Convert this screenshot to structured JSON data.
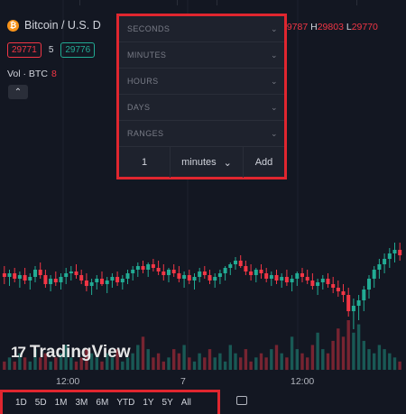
{
  "symbol": {
    "title": "Bitcoin / U.S. D",
    "coin_glyph": "₿",
    "ohlc": {
      "close_value": "29787",
      "high_label": "H",
      "high_value": "29803",
      "low_label": "L",
      "low_value": "29770"
    },
    "sell_price": "29771",
    "spread": "5",
    "buy_price": "29776"
  },
  "volume": {
    "label": "Vol · BTC",
    "value": "8"
  },
  "collapse_glyph": "⌃",
  "interval_panel": {
    "sections": [
      "SECONDS",
      "MINUTES",
      "HOURS",
      "DAYS",
      "RANGES"
    ],
    "chevron": "⌄",
    "custom": {
      "value": "1",
      "unit": "minutes",
      "unit_chevron": "⌄",
      "add_label": "Add"
    }
  },
  "logo": {
    "mark": "17",
    "text": "TradingView"
  },
  "xaxis": {
    "labels": [
      "12:00",
      "7",
      "12:00"
    ]
  },
  "range_bar": {
    "items": [
      "1D",
      "5D",
      "1M",
      "3M",
      "6M",
      "YTD",
      "1Y",
      "5Y",
      "All"
    ]
  },
  "colors": {
    "up": "#22ab94",
    "down": "#f23645",
    "highlight": "#e0262f",
    "background": "#131722"
  },
  "chart_data": {
    "type": "candlestick",
    "x_labels": [
      "12:00",
      "7",
      "12:00"
    ],
    "candles": [
      [
        29786,
        29790,
        29780,
        29784
      ],
      [
        29784,
        29788,
        29779,
        29786
      ],
      [
        29786,
        29789,
        29781,
        29783
      ],
      [
        29783,
        29787,
        29778,
        29785
      ],
      [
        29785,
        29789,
        29780,
        29782
      ],
      [
        29782,
        29786,
        29777,
        29784
      ],
      [
        29784,
        29790,
        29781,
        29788
      ],
      [
        29788,
        29792,
        29783,
        29785
      ],
      [
        29785,
        29788,
        29778,
        29780
      ],
      [
        29780,
        29785,
        29776,
        29783
      ],
      [
        29783,
        29787,
        29779,
        29781
      ],
      [
        29781,
        29786,
        29777,
        29784
      ],
      [
        29784,
        29789,
        29780,
        29786
      ],
      [
        29786,
        29790,
        29782,
        29787
      ],
      [
        29787,
        29791,
        29783,
        29785
      ],
      [
        29785,
        29788,
        29780,
        29782
      ],
      [
        29782,
        29786,
        29776,
        29779
      ],
      [
        29779,
        29783,
        29774,
        29781
      ],
      [
        29781,
        29785,
        29777,
        29783
      ],
      [
        29783,
        29787,
        29779,
        29780
      ],
      [
        29780,
        29784,
        29775,
        29782
      ],
      [
        29782,
        29786,
        29778,
        29784
      ],
      [
        29784,
        29787,
        29779,
        29781
      ],
      [
        29781,
        29785,
        29777,
        29783
      ],
      [
        29783,
        29788,
        29780,
        29786
      ],
      [
        29786,
        29790,
        29782,
        29788
      ],
      [
        29788,
        29792,
        29784,
        29790
      ],
      [
        29790,
        29793,
        29786,
        29788
      ],
      [
        29788,
        29792,
        29784,
        29791
      ],
      [
        29791,
        29794,
        29787,
        29789
      ],
      [
        29789,
        29793,
        29785,
        29787
      ],
      [
        29787,
        29791,
        29782,
        29785
      ],
      [
        29785,
        29789,
        29781,
        29788
      ],
      [
        29788,
        29791,
        29784,
        29786
      ],
      [
        29786,
        29790,
        29781,
        29783
      ],
      [
        29783,
        29787,
        29778,
        29785
      ],
      [
        29785,
        29788,
        29780,
        29782
      ],
      [
        29782,
        29786,
        29777,
        29784
      ],
      [
        29784,
        29789,
        29781,
        29787
      ],
      [
        29787,
        29790,
        29783,
        29785
      ],
      [
        29785,
        29788,
        29780,
        29782
      ],
      [
        29782,
        29786,
        29778,
        29784
      ],
      [
        29784,
        29788,
        29780,
        29786
      ],
      [
        29786,
        29790,
        29782,
        29789
      ],
      [
        29789,
        29792,
        29785,
        29791
      ],
      [
        29791,
        29795,
        29788,
        29793
      ],
      [
        29793,
        29796,
        29789,
        29790
      ],
      [
        29790,
        29793,
        29785,
        29787
      ],
      [
        29787,
        29791,
        29782,
        29785
      ],
      [
        29785,
        29789,
        29781,
        29788
      ],
      [
        29788,
        29791,
        29783,
        29786
      ],
      [
        29786,
        29789,
        29781,
        29783
      ],
      [
        29783,
        29787,
        29779,
        29785
      ],
      [
        29785,
        29788,
        29780,
        29782
      ],
      [
        29782,
        29786,
        29778,
        29784
      ],
      [
        29784,
        29788,
        29779,
        29781
      ],
      [
        29781,
        29785,
        29776,
        29783
      ],
      [
        29783,
        29787,
        29779,
        29786
      ],
      [
        29786,
        29789,
        29781,
        29784
      ],
      [
        29784,
        29788,
        29780,
        29782
      ],
      [
        29782,
        29786,
        29777,
        29779
      ],
      [
        29779,
        29783,
        29774,
        29781
      ],
      [
        29781,
        29785,
        29777,
        29783
      ],
      [
        29783,
        29786,
        29778,
        29780
      ],
      [
        29780,
        29784,
        29775,
        29778
      ],
      [
        29778,
        29782,
        29773,
        29776
      ],
      [
        29776,
        29780,
        29770,
        29774
      ],
      [
        29774,
        29778,
        29762,
        29765
      ],
      [
        29765,
        29772,
        29755,
        29768
      ],
      [
        29768,
        29774,
        29760,
        29771
      ],
      [
        29771,
        29779,
        29765,
        29777
      ],
      [
        29777,
        29785,
        29772,
        29783
      ],
      [
        29783,
        29790,
        29778,
        29788
      ],
      [
        29788,
        29794,
        29783,
        29791
      ],
      [
        29791,
        29797,
        29786,
        29794
      ],
      [
        29794,
        29800,
        29789,
        29797
      ],
      [
        29797,
        29803,
        29792,
        29799
      ],
      [
        29799,
        29803,
        29793,
        29796
      ]
    ],
    "volume": [
      2,
      3,
      2,
      4,
      3,
      2,
      5,
      3,
      4,
      2,
      3,
      4,
      6,
      3,
      2,
      3,
      5,
      4,
      3,
      2,
      4,
      3,
      5,
      2,
      3,
      4,
      6,
      8,
      5,
      3,
      4,
      2,
      3,
      5,
      4,
      6,
      3,
      2,
      4,
      3,
      5,
      3,
      4,
      2,
      6,
      4,
      3,
      5,
      2,
      3,
      4,
      3,
      5,
      6,
      4,
      3,
      8,
      5,
      4,
      3,
      6,
      9,
      5,
      4,
      7,
      10,
      8,
      12,
      9,
      11,
      7,
      5,
      4,
      6,
      5,
      4,
      3,
      2
    ]
  }
}
